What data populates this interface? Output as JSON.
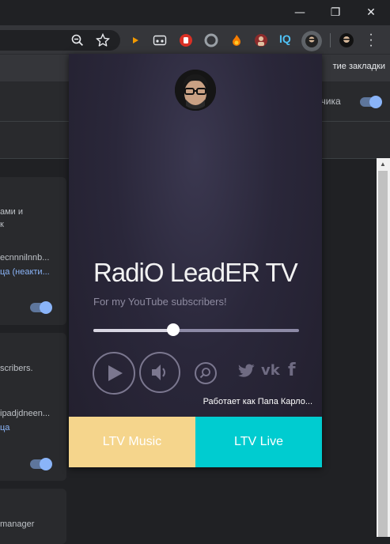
{
  "browser": {
    "bookmarks_bar_text": "тие закладки"
  },
  "page": {
    "header_right_label": "тчика",
    "cards": [
      {
        "lines": [
          "ами и",
          "к"
        ],
        "id_text": "ecnnnilnnb...",
        "link": "ца (неакти..."
      },
      {
        "lines": [
          "scribers."
        ],
        "id_text": "ipadjdneen...",
        "link": "ца"
      },
      {
        "lines": [
          "manager"
        ]
      }
    ]
  },
  "popup": {
    "title": "RadiO LeadER TV",
    "subtitle": "For my YouTube subscribers!",
    "volume_level": 0.39,
    "credit": "Работает как Папа Карло...",
    "tabs": {
      "music": "LTV Music",
      "live": "LTV Live"
    },
    "colors": {
      "music_tab": "#f5d58c",
      "live_tab": "#00ccd0"
    }
  }
}
